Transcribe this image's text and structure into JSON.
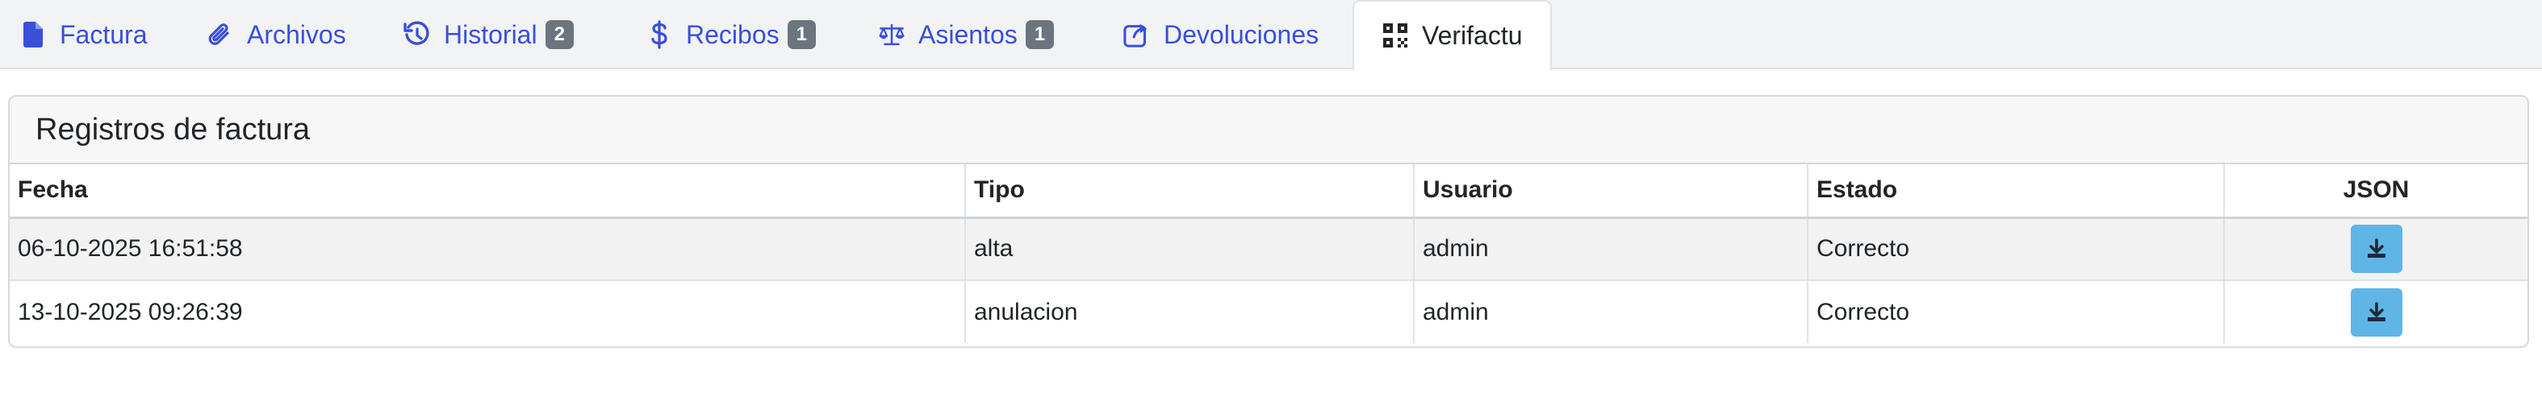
{
  "tabs": [
    {
      "label": "Factura",
      "icon": "file-icon",
      "badge": null,
      "active": false
    },
    {
      "label": "Archivos",
      "icon": "paperclip-icon",
      "badge": null,
      "active": false
    },
    {
      "label": "Historial",
      "icon": "history-icon",
      "badge": "2",
      "active": false
    },
    {
      "label": "Recibos",
      "icon": "dollar-icon",
      "badge": "1",
      "active": false
    },
    {
      "label": "Asientos",
      "icon": "balance-scale-icon",
      "badge": "1",
      "active": false
    },
    {
      "label": "Devoluciones",
      "icon": "share-icon",
      "badge": null,
      "active": false
    },
    {
      "label": "Verifactu",
      "icon": "qrcode-icon",
      "badge": null,
      "active": true
    }
  ],
  "card": {
    "title": "Registros de factura",
    "columns": [
      "Fecha",
      "Tipo",
      "Usuario",
      "Estado",
      "JSON"
    ],
    "rows": [
      {
        "fecha": "06-10-2025 16:51:58",
        "tipo": "alta",
        "usuario": "admin",
        "estado": "Correcto"
      },
      {
        "fecha": "13-10-2025 09:26:39",
        "tipo": "anulacion",
        "usuario": "admin",
        "estado": "Correcto"
      }
    ]
  },
  "colors": {
    "link": "#3a4fd8",
    "badge": "#6c757d",
    "download_button": "#5fb6e6"
  }
}
